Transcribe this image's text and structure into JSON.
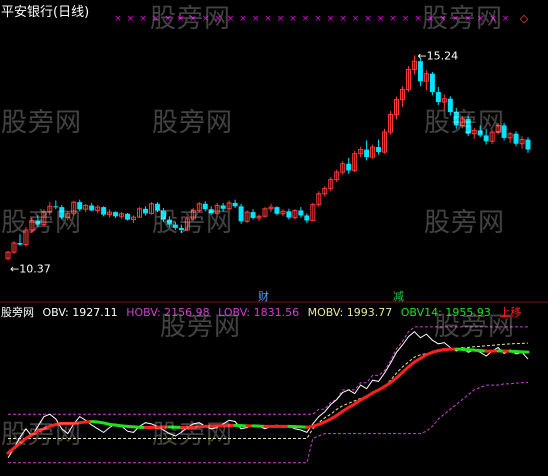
{
  "title": "平安银行(日线)",
  "watermark": "股旁网",
  "chart_data": [
    {
      "type": "candlestick",
      "title": "平安银行(日线)",
      "price_high_label": "15.24",
      "price_low_label": "10.37",
      "up_color": "#ff3b3b",
      "down_color": "#00e5ff",
      "marker_color": "#e000e0",
      "ylim": [
        9.9,
        15.8
      ],
      "candles": [
        [
          10.37,
          10.55,
          10.32,
          10.52
        ],
        [
          10.52,
          10.78,
          10.48,
          10.74
        ],
        [
          10.74,
          10.95,
          10.68,
          10.7
        ],
        [
          10.7,
          11.12,
          10.65,
          11.05
        ],
        [
          11.05,
          11.35,
          10.98,
          11.28
        ],
        [
          11.28,
          11.4,
          11.12,
          11.18
        ],
        [
          11.18,
          11.55,
          11.15,
          11.49
        ],
        [
          11.49,
          11.72,
          11.4,
          11.62
        ],
        [
          11.62,
          11.76,
          11.55,
          11.6
        ],
        [
          11.6,
          11.65,
          11.3,
          11.35
        ],
        [
          11.35,
          11.5,
          11.28,
          11.45
        ],
        [
          11.45,
          11.75,
          11.4,
          11.72
        ],
        [
          11.72,
          11.78,
          11.5,
          11.55
        ],
        [
          11.55,
          11.68,
          11.48,
          11.64
        ],
        [
          11.64,
          11.7,
          11.5,
          11.52
        ],
        [
          11.52,
          11.65,
          11.45,
          11.6
        ],
        [
          11.6,
          11.62,
          11.38,
          11.42
        ],
        [
          11.42,
          11.55,
          11.35,
          11.48
        ],
        [
          11.48,
          11.5,
          11.34,
          11.38
        ],
        [
          11.38,
          11.48,
          11.32,
          11.44
        ],
        [
          11.44,
          11.46,
          11.28,
          11.3
        ],
        [
          11.3,
          11.4,
          11.22,
          11.36
        ],
        [
          11.36,
          11.6,
          11.34,
          11.56
        ],
        [
          11.56,
          11.62,
          11.4,
          11.45
        ],
        [
          11.45,
          11.72,
          11.42,
          11.68
        ],
        [
          11.68,
          11.72,
          11.48,
          11.52
        ],
        [
          11.52,
          11.58,
          11.25,
          11.3
        ],
        [
          11.3,
          11.38,
          11.12,
          11.18
        ],
        [
          11.18,
          11.25,
          11.05,
          11.1
        ],
        [
          11.1,
          11.18,
          10.98,
          11.05
        ],
        [
          11.05,
          11.35,
          11.02,
          11.32
        ],
        [
          11.32,
          11.58,
          11.28,
          11.52
        ],
        [
          11.52,
          11.72,
          11.48,
          11.68
        ],
        [
          11.68,
          11.74,
          11.5,
          11.55
        ],
        [
          11.55,
          11.62,
          11.4,
          11.45
        ],
        [
          11.45,
          11.7,
          11.42,
          11.64
        ],
        [
          11.64,
          11.7,
          11.5,
          11.56
        ],
        [
          11.56,
          11.76,
          11.52,
          11.7
        ],
        [
          11.7,
          11.78,
          11.58,
          11.62
        ],
        [
          11.62,
          11.68,
          11.2,
          11.26
        ],
        [
          11.26,
          11.52,
          11.22,
          11.48
        ],
        [
          11.48,
          11.55,
          11.3,
          11.34
        ],
        [
          11.34,
          11.42,
          11.26,
          11.38
        ],
        [
          11.38,
          11.6,
          11.36,
          11.56
        ],
        [
          11.56,
          11.68,
          11.48,
          11.6
        ],
        [
          11.6,
          11.62,
          11.4,
          11.44
        ],
        [
          11.44,
          11.55,
          11.38,
          11.5
        ],
        [
          11.5,
          11.56,
          11.3,
          11.35
        ],
        [
          11.35,
          11.55,
          11.3,
          11.52
        ],
        [
          11.52,
          11.6,
          11.35,
          11.4
        ],
        [
          11.4,
          11.45,
          11.22,
          11.28
        ],
        [
          11.28,
          11.7,
          11.26,
          11.66
        ],
        [
          11.66,
          11.98,
          11.6,
          11.92
        ],
        [
          11.92,
          12.1,
          11.85,
          12.05
        ],
        [
          12.05,
          12.32,
          11.98,
          12.26
        ],
        [
          12.26,
          12.5,
          12.2,
          12.44
        ],
        [
          12.44,
          12.7,
          12.38,
          12.64
        ],
        [
          12.64,
          12.78,
          12.4,
          12.48
        ],
        [
          12.48,
          12.95,
          12.44,
          12.88
        ],
        [
          12.88,
          13.05,
          12.8,
          12.98
        ],
        [
          12.98,
          13.2,
          12.72,
          12.8
        ],
        [
          12.8,
          13.1,
          12.76,
          13.04
        ],
        [
          13.04,
          13.22,
          12.86,
          12.92
        ],
        [
          12.92,
          13.48,
          12.88,
          13.4
        ],
        [
          13.4,
          13.9,
          13.34,
          13.82
        ],
        [
          13.82,
          14.25,
          13.7,
          14.18
        ],
        [
          14.18,
          14.5,
          14.0,
          14.42
        ],
        [
          14.42,
          14.98,
          14.36,
          14.9
        ],
        [
          14.9,
          15.24,
          14.78,
          15.1
        ],
        [
          15.1,
          15.18,
          14.5,
          14.62
        ],
        [
          14.62,
          14.88,
          14.4,
          14.8
        ],
        [
          14.8,
          14.84,
          14.28,
          14.36
        ],
        [
          14.36,
          14.48,
          14.05,
          14.12
        ],
        [
          14.12,
          14.3,
          13.92,
          14.2
        ],
        [
          14.2,
          14.26,
          13.8,
          13.88
        ],
        [
          13.88,
          13.98,
          13.48,
          13.56
        ],
        [
          13.56,
          13.78,
          13.5,
          13.72
        ],
        [
          13.72,
          13.78,
          13.3,
          13.36
        ],
        [
          13.36,
          13.5,
          13.24,
          13.44
        ],
        [
          13.44,
          13.56,
          13.28,
          13.32
        ],
        [
          13.32,
          13.48,
          13.1,
          13.18
        ],
        [
          13.18,
          13.46,
          13.12,
          13.4
        ],
        [
          13.4,
          13.62,
          13.34,
          13.56
        ],
        [
          13.56,
          13.62,
          13.2,
          13.26
        ],
        [
          13.26,
          13.4,
          13.14,
          13.36
        ],
        [
          13.36,
          13.42,
          13.06,
          13.12
        ],
        [
          13.12,
          13.3,
          13.0,
          13.22
        ],
        [
          13.22,
          13.28,
          12.9,
          12.98
        ]
      ]
    },
    {
      "type": "line",
      "title": "股旁网",
      "series": [
        {
          "name": "OBV",
          "label": "OBV: 1927.11",
          "color": "#ffffff",
          "values": [
            1520,
            1560,
            1605,
            1640,
            1610,
            1650,
            1690,
            1700,
            1680,
            1640,
            1620,
            1660,
            1690,
            1675,
            1655,
            1640,
            1625,
            1645,
            1660,
            1650,
            1630,
            1625,
            1650,
            1665,
            1660,
            1650,
            1635,
            1620,
            1610,
            1625,
            1645,
            1660,
            1665,
            1650,
            1640,
            1645,
            1660,
            1675,
            1670,
            1640,
            1645,
            1655,
            1650,
            1640,
            1650,
            1655,
            1645,
            1650,
            1640,
            1635,
            1625,
            1660,
            1690,
            1710,
            1740,
            1760,
            1790,
            1800,
            1785,
            1820,
            1805,
            1840,
            1835,
            1870,
            1910,
            1955,
            1985,
            2020,
            2040,
            2015,
            2030,
            2005,
            1990,
            1995,
            1975,
            1960,
            1975,
            1955,
            1965,
            1955,
            1940,
            1960,
            1975,
            1950,
            1965,
            1948,
            1955,
            1927
          ]
        },
        {
          "name": "HOBV",
          "label": "HOBV: 2156.98",
          "color": "#cc44cc",
          "values": [
            1700,
            1700,
            1700,
            1700,
            1700,
            1700,
            1700,
            1700,
            1700,
            1700,
            1700,
            1700,
            1700,
            1700,
            1700,
            1700,
            1700,
            1700,
            1700,
            1700,
            1700,
            1700,
            1700,
            1700,
            1700,
            1700,
            1700,
            1700,
            1700,
            1700,
            1700,
            1700,
            1700,
            1700,
            1700,
            1700,
            1700,
            1700,
            1700,
            1700,
            1700,
            1700,
            1700,
            1700,
            1700,
            1700,
            1700,
            1700,
            1700,
            1700,
            1700,
            1700,
            1720,
            1720,
            1750,
            1760,
            1800,
            1800,
            1800,
            1830,
            1830,
            1860,
            1860,
            1880,
            1920,
            1970,
            2000,
            2040,
            2060,
            2060,
            2060,
            2060,
            2060,
            2060,
            2060,
            2060,
            2060,
            2060,
            2060,
            2060,
            2060,
            2060,
            2060,
            2060,
            2060,
            2060,
            2060,
            2060
          ]
        },
        {
          "name": "LOBV",
          "label": "LOBV: 1831.56",
          "color": "#cc44cc",
          "values": [
            1500,
            1500,
            1500,
            1500,
            1500,
            1500,
            1500,
            1500,
            1500,
            1500,
            1500,
            1500,
            1500,
            1500,
            1500,
            1500,
            1500,
            1500,
            1500,
            1500,
            1500,
            1500,
            1500,
            1500,
            1500,
            1500,
            1500,
            1500,
            1500,
            1500,
            1500,
            1500,
            1500,
            1500,
            1500,
            1500,
            1500,
            1500,
            1500,
            1500,
            1500,
            1500,
            1500,
            1500,
            1500,
            1500,
            1500,
            1500,
            1500,
            1500,
            1500,
            1600,
            1610,
            1620,
            1620,
            1620,
            1620,
            1620,
            1620,
            1620,
            1620,
            1620,
            1620,
            1620,
            1620,
            1620,
            1620,
            1620,
            1620,
            1620,
            1630,
            1650,
            1680,
            1700,
            1720,
            1740,
            1760,
            1780,
            1800,
            1810,
            1820,
            1820,
            1820,
            1825,
            1825,
            1828,
            1830,
            1831
          ]
        },
        {
          "name": "MOBV",
          "label": "MOBV: 1993.77",
          "color": "#e8e8a0",
          "values": [
            1600,
            1600,
            1600,
            1600,
            1600,
            1600,
            1600,
            1600,
            1600,
            1600,
            1600,
            1600,
            1600,
            1600,
            1600,
            1600,
            1600,
            1600,
            1600,
            1600,
            1600,
            1600,
            1600,
            1600,
            1600,
            1600,
            1600,
            1600,
            1600,
            1600,
            1600,
            1600,
            1600,
            1600,
            1600,
            1600,
            1600,
            1600,
            1600,
            1600,
            1600,
            1600,
            1600,
            1600,
            1600,
            1600,
            1600,
            1600,
            1600,
            1600,
            1600,
            1640,
            1665,
            1685,
            1700,
            1720,
            1735,
            1745,
            1755,
            1765,
            1775,
            1790,
            1800,
            1815,
            1840,
            1870,
            1895,
            1915,
            1935,
            1945,
            1950,
            1955,
            1960,
            1965,
            1968,
            1970,
            1972,
            1975,
            1978,
            1980,
            1982,
            1984,
            1986,
            1988,
            1990,
            1991,
            1992,
            1993
          ]
        },
        {
          "name": "OBV14",
          "label": "OBV14: 1955.93",
          "color": "#ff2020",
          "color_falling": "#20e020",
          "values": [
            1540,
            1560,
            1580,
            1600,
            1615,
            1630,
            1640,
            1650,
            1658,
            1662,
            1662,
            1662,
            1665,
            1668,
            1670,
            1668,
            1664,
            1658,
            1655,
            1652,
            1650,
            1648,
            1646,
            1645,
            1645,
            1646,
            1647,
            1647,
            1646,
            1645,
            1645,
            1646,
            1648,
            1650,
            1651,
            1652,
            1652,
            1653,
            1654,
            1653,
            1652,
            1652,
            1651,
            1650,
            1650,
            1650,
            1650,
            1650,
            1649,
            1648,
            1646,
            1650,
            1658,
            1668,
            1680,
            1695,
            1712,
            1728,
            1742,
            1758,
            1772,
            1788,
            1800,
            1814,
            1830,
            1850,
            1872,
            1895,
            1915,
            1930,
            1945,
            1955,
            1962,
            1966,
            1968,
            1968,
            1967,
            1966,
            1964,
            1962,
            1960,
            1960,
            1961,
            1960,
            1960,
            1958,
            1957,
            1956
          ]
        }
      ],
      "extra_label": "上移",
      "ylim": [
        1470,
        2080
      ]
    }
  ],
  "badges": {
    "cai": "财",
    "jian": "减"
  }
}
